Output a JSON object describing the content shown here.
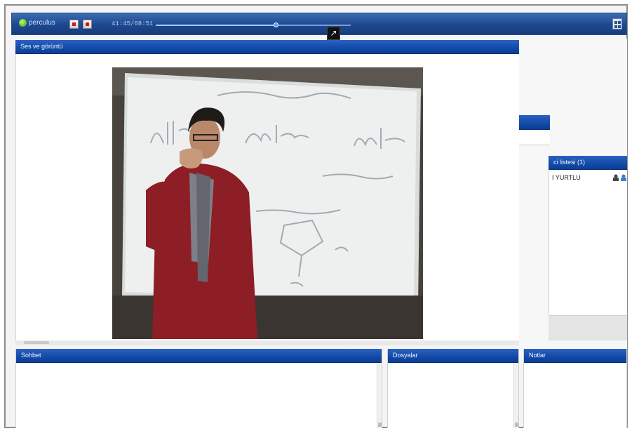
{
  "toolbar": {
    "logo_text": "perculus",
    "time": "41:45/68:51",
    "progress_fraction": 0.62,
    "stop_color": "#c41a1a",
    "record_color": "#d10f0f"
  },
  "video_panel": {
    "title": "Ses ve görüntü"
  },
  "users_panel": {
    "title": "ci listesi (1)",
    "users": [
      {
        "name": "I YURTLU"
      }
    ]
  },
  "chat_panel": {
    "title": "Sohbet"
  },
  "files_panel": {
    "title": "Dosyalar"
  },
  "notes_panel": {
    "title": "Notlar"
  },
  "colors": {
    "header_blue": "#114aa8",
    "toolbar_blue": "#1d4890"
  }
}
